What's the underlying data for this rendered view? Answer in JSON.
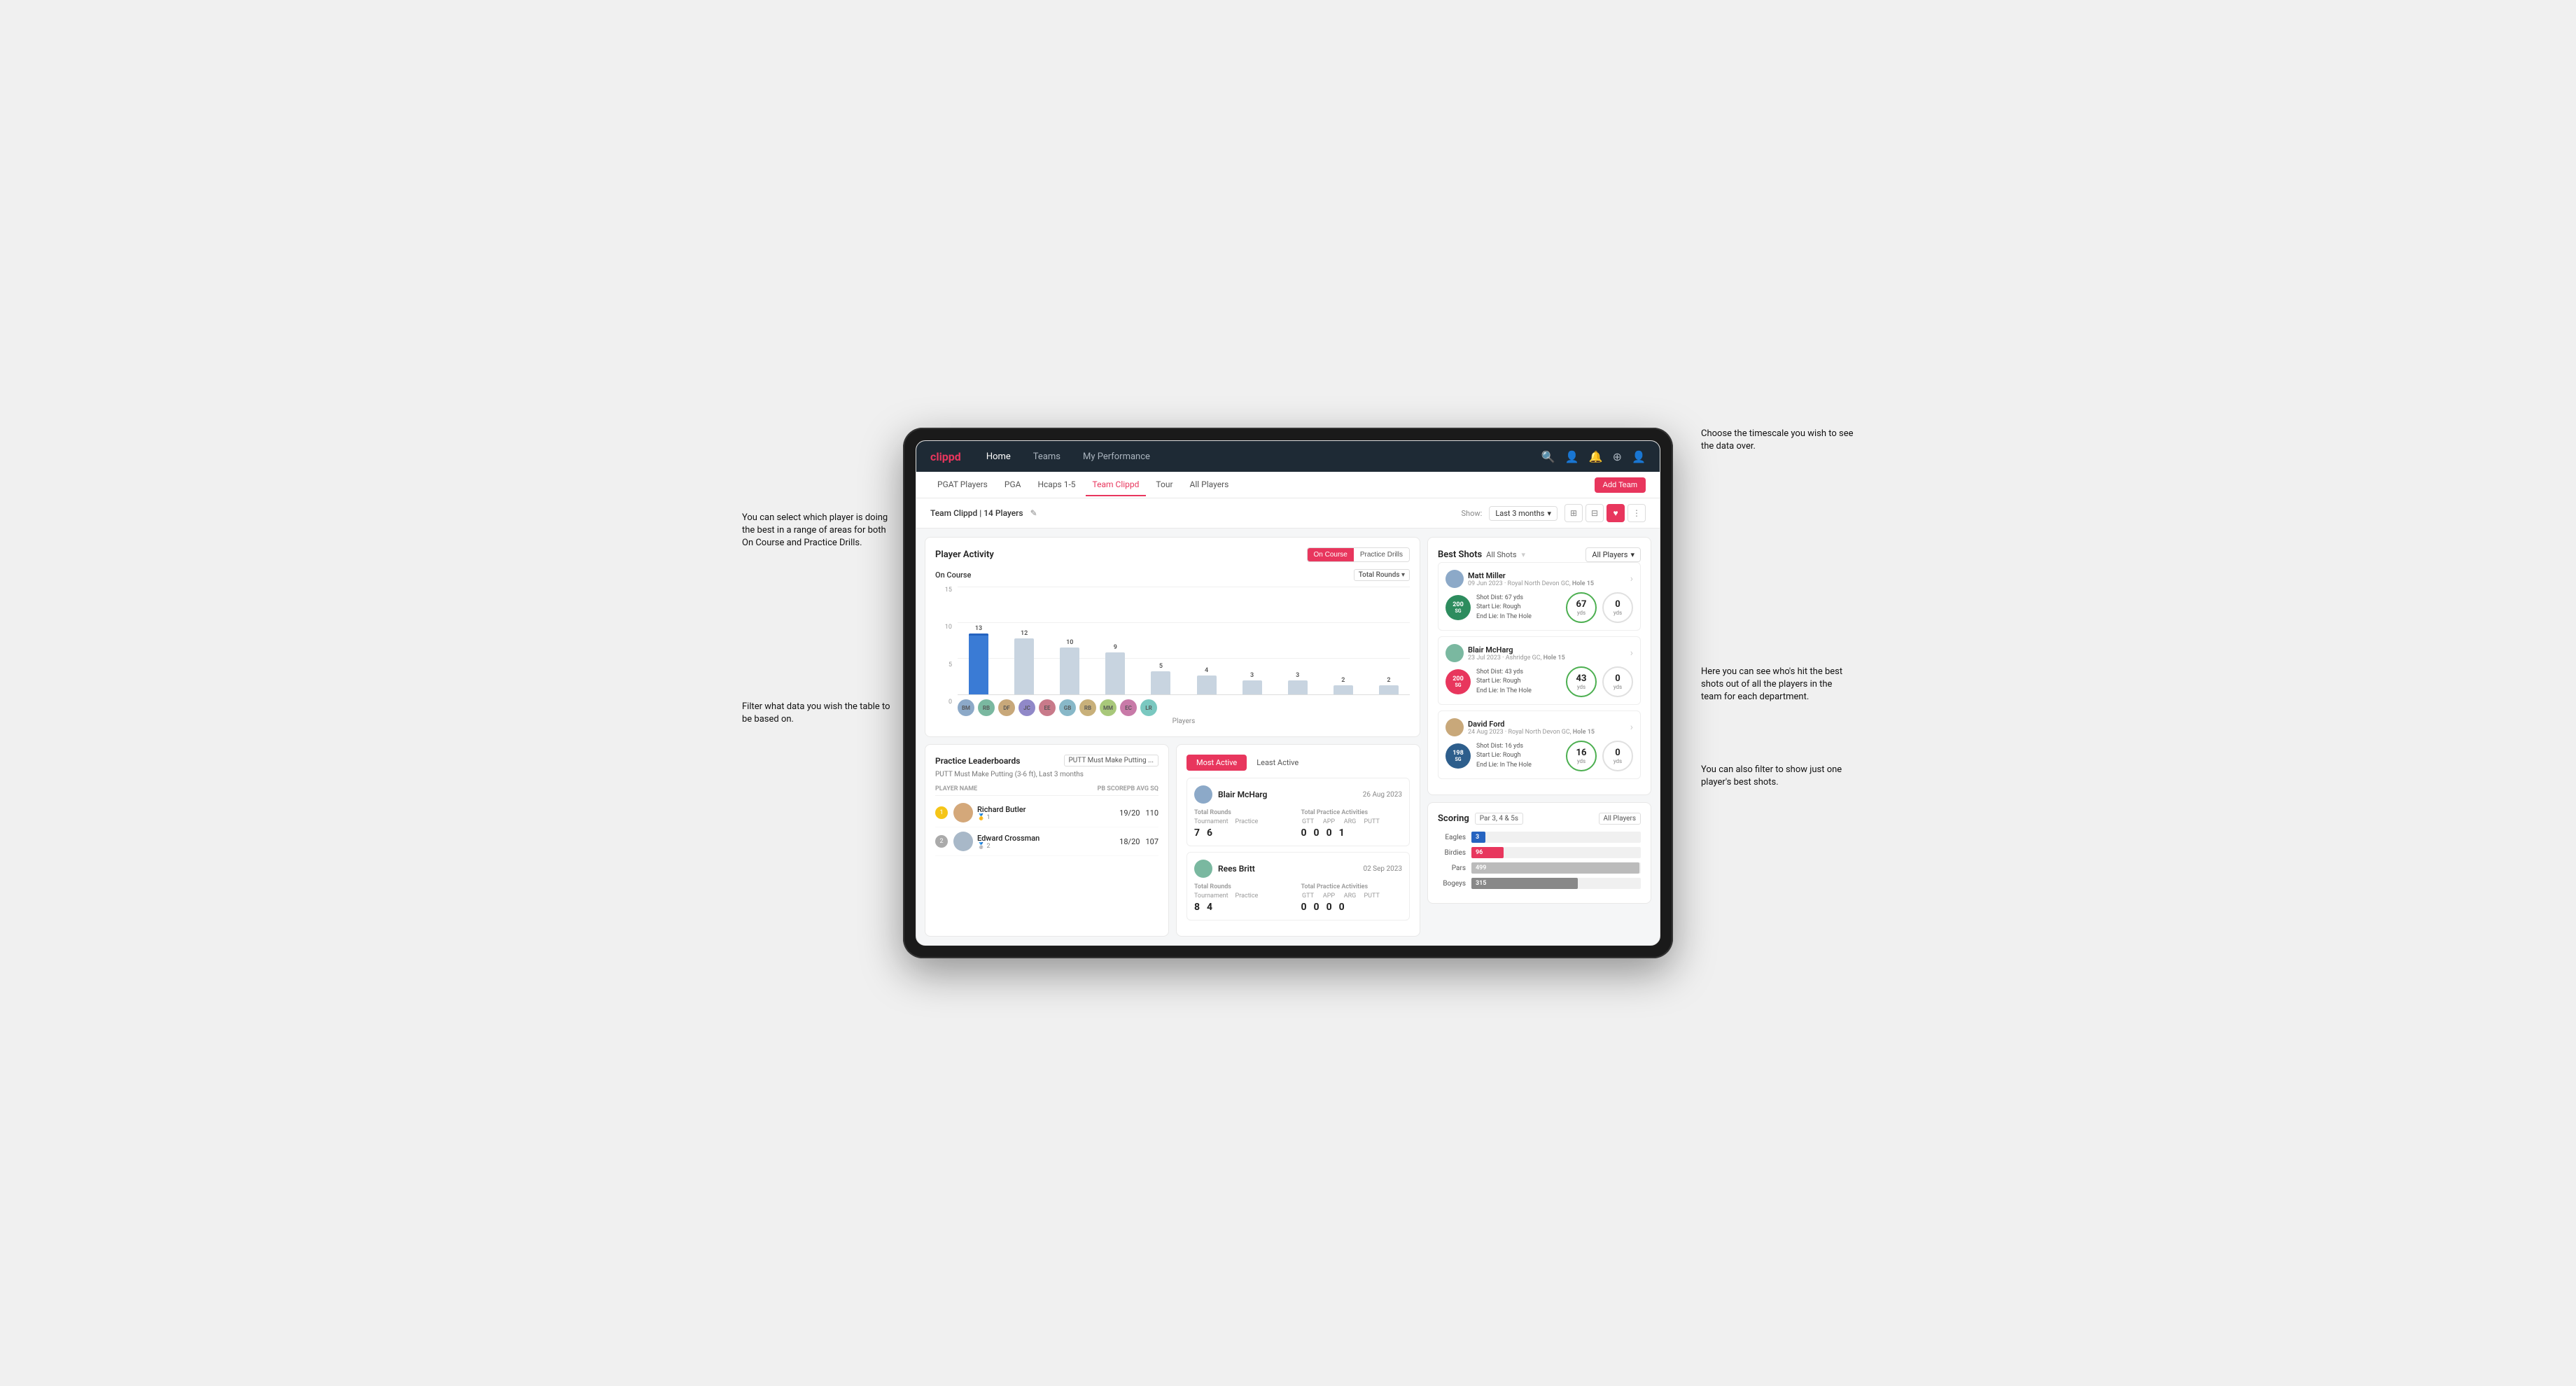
{
  "annotations": {
    "top_right": "Choose the timescale you wish to see the data over.",
    "left_top": "You can select which player is doing the best in a range of areas for both On Course and Practice Drills.",
    "left_bottom": "Filter what data you wish the table to be based on.",
    "right_mid": "Here you can see who's hit the best shots out of all the players in the team for each department.",
    "right_bottom": "You can also filter to show just one player's best shots."
  },
  "nav": {
    "logo": "clippd",
    "links": [
      "Home",
      "Teams",
      "My Performance"
    ],
    "icons": [
      "search",
      "users",
      "bell",
      "plus",
      "user"
    ]
  },
  "sub_nav": {
    "links": [
      "PGAT Players",
      "PGA",
      "Hcaps 1-5",
      "Team Clippd",
      "Tour",
      "All Players"
    ],
    "active": "Team Clippd",
    "add_btn": "Add Team"
  },
  "team_header": {
    "title": "Team Clippd | 14 Players",
    "show_label": "Show:",
    "show_value": "Last 3 months",
    "chevron": "▾"
  },
  "player_activity": {
    "title": "Player Activity",
    "toggle_on": "On Course",
    "toggle_practice": "Practice Drills",
    "section": "On Course",
    "dropdown": "Total Rounds",
    "y_labels": [
      "15",
      "10",
      "5",
      "0"
    ],
    "bars": [
      {
        "name": "B. McHarg",
        "value": 13,
        "height": 87
      },
      {
        "name": "R. Britt",
        "value": 12,
        "height": 80
      },
      {
        "name": "D. Ford",
        "value": 10,
        "height": 67
      },
      {
        "name": "J. Coles",
        "value": 9,
        "height": 60
      },
      {
        "name": "E. Ebert",
        "value": 5,
        "height": 33
      },
      {
        "name": "G. Billingham",
        "value": 4,
        "height": 27
      },
      {
        "name": "R. Butler",
        "value": 3,
        "height": 20
      },
      {
        "name": "M. Miller",
        "value": 3,
        "height": 20
      },
      {
        "name": "E. Crossman",
        "value": 2,
        "height": 13
      },
      {
        "name": "L. Robertson",
        "value": 2,
        "height": 13
      }
    ],
    "x_label": "Players"
  },
  "best_shots": {
    "title": "Best Shots",
    "tab_all": "All Shots",
    "tab_players": "All Players",
    "players": [
      {
        "name": "Matt Miller",
        "date": "09 Jun 2023",
        "course": "Royal North Devon GC",
        "hole": "Hole 15",
        "badge": "200 SG",
        "dist": "Shot Dist: 67 yds",
        "start": "Start Lie: Rough",
        "end": "End Lie: In The Hole",
        "yds": 67,
        "carry": 0
      },
      {
        "name": "Blair McHarg",
        "date": "23 Jul 2023",
        "course": "Ashridge GC",
        "hole": "Hole 15",
        "badge": "200 SG",
        "dist": "Shot Dist: 43 yds",
        "start": "Start Lie: Rough",
        "end": "End Lie: In The Hole",
        "yds": 43,
        "carry": 0
      },
      {
        "name": "David Ford",
        "date": "24 Aug 2023",
        "course": "Royal North Devon GC",
        "hole": "Hole 15",
        "badge": "198 SG",
        "dist": "Shot Dist: 16 yds",
        "start": "Start Lie: Rough",
        "end": "End Lie: In The Hole",
        "yds": 16,
        "carry": 0
      }
    ]
  },
  "practice_leaderboard": {
    "title": "Practice Leaderboards",
    "dropdown": "PUTT Must Make Putting ...",
    "sub": "PUTT Must Make Putting (3-6 ft), Last 3 months",
    "col_name": "PLAYER NAME",
    "col_pb": "PB SCORE",
    "col_avg": "PB AVG SQ",
    "players": [
      {
        "rank": 1,
        "name": "Richard Butler",
        "sub": "1",
        "pb": "19/20",
        "avg": "110"
      },
      {
        "rank": 2,
        "name": "Edward Crossman",
        "sub": "2",
        "pb": "18/20",
        "avg": "107"
      }
    ]
  },
  "activity": {
    "tab_active": "Most Active",
    "tab_least": "Least Active",
    "players": [
      {
        "name": "Blair McHarg",
        "date": "26 Aug 2023",
        "total_rounds_label": "Total Rounds",
        "tournament": 7,
        "practice": 6,
        "practice_label": "Total Practice Activities",
        "gtt": 0,
        "app": 0,
        "arg": 0,
        "putt": 1
      },
      {
        "name": "Rees Britt",
        "date": "02 Sep 2023",
        "total_rounds_label": "Total Rounds",
        "tournament": 8,
        "practice": 4,
        "practice_label": "Total Practice Activities",
        "gtt": 0,
        "app": 0,
        "arg": 0,
        "putt": 0
      }
    ]
  },
  "scoring": {
    "title": "Scoring",
    "dropdown1": "Par 3, 4 & 5s",
    "dropdown2": "All Players",
    "rows": [
      {
        "label": "Eagles",
        "value": 3,
        "max": 500,
        "color": "#2563c0"
      },
      {
        "label": "Birdies",
        "value": 96,
        "max": 500,
        "color": "#e8365d"
      },
      {
        "label": "Pars",
        "value": 499,
        "max": 500,
        "color": "#aaa"
      },
      {
        "label": "Bogeys",
        "value": 315,
        "max": 500,
        "color": "#888"
      }
    ]
  },
  "colors": {
    "brand_red": "#e8365d",
    "nav_bg": "#1e2a35",
    "bar_default": "#c8d4e0",
    "bar_highlight": "#3a7bd5"
  }
}
